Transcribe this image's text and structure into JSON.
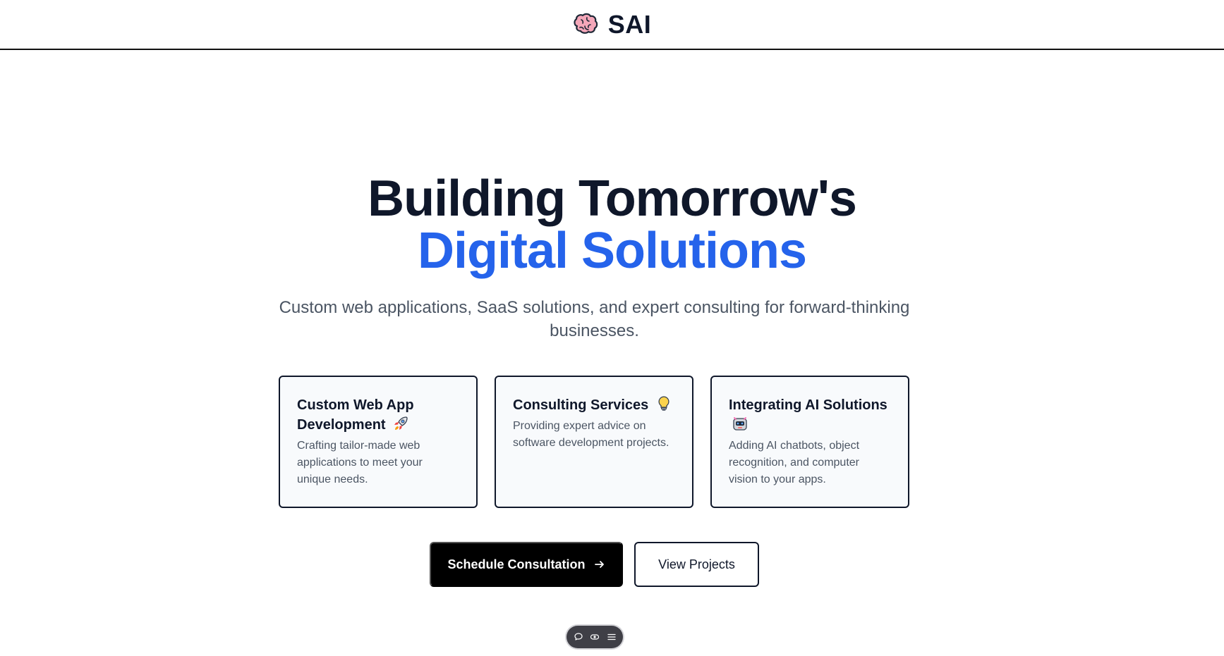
{
  "header": {
    "brand_name": "SAI",
    "brand_icon": "brain-icon"
  },
  "hero": {
    "headline_line1": "Building Tomorrow's",
    "headline_line2": "Digital Solutions",
    "headline_accent_color": "#2563eb",
    "subtitle": "Custom web applications, SaaS solutions, and expert consulting for forward-thinking businesses."
  },
  "services": [
    {
      "title": "Custom Web App Development",
      "icon": "rocket-icon",
      "description": "Crafting tailor-made web applications to meet your unique needs."
    },
    {
      "title": "Consulting Services",
      "icon": "lightbulb-icon",
      "description": "Providing expert advice on software development projects."
    },
    {
      "title": "Integrating AI Solutions",
      "icon": "robot-icon",
      "description": "Adding AI chatbots, object recognition, and computer vision to your apps."
    }
  ],
  "actions": {
    "primary_label": "Schedule Consultation",
    "primary_icon": "arrow-right-icon",
    "secondary_label": "View Projects"
  },
  "floating_toolbar": {
    "icons": [
      "chat-icon",
      "eye-icon",
      "menu-icon"
    ]
  }
}
